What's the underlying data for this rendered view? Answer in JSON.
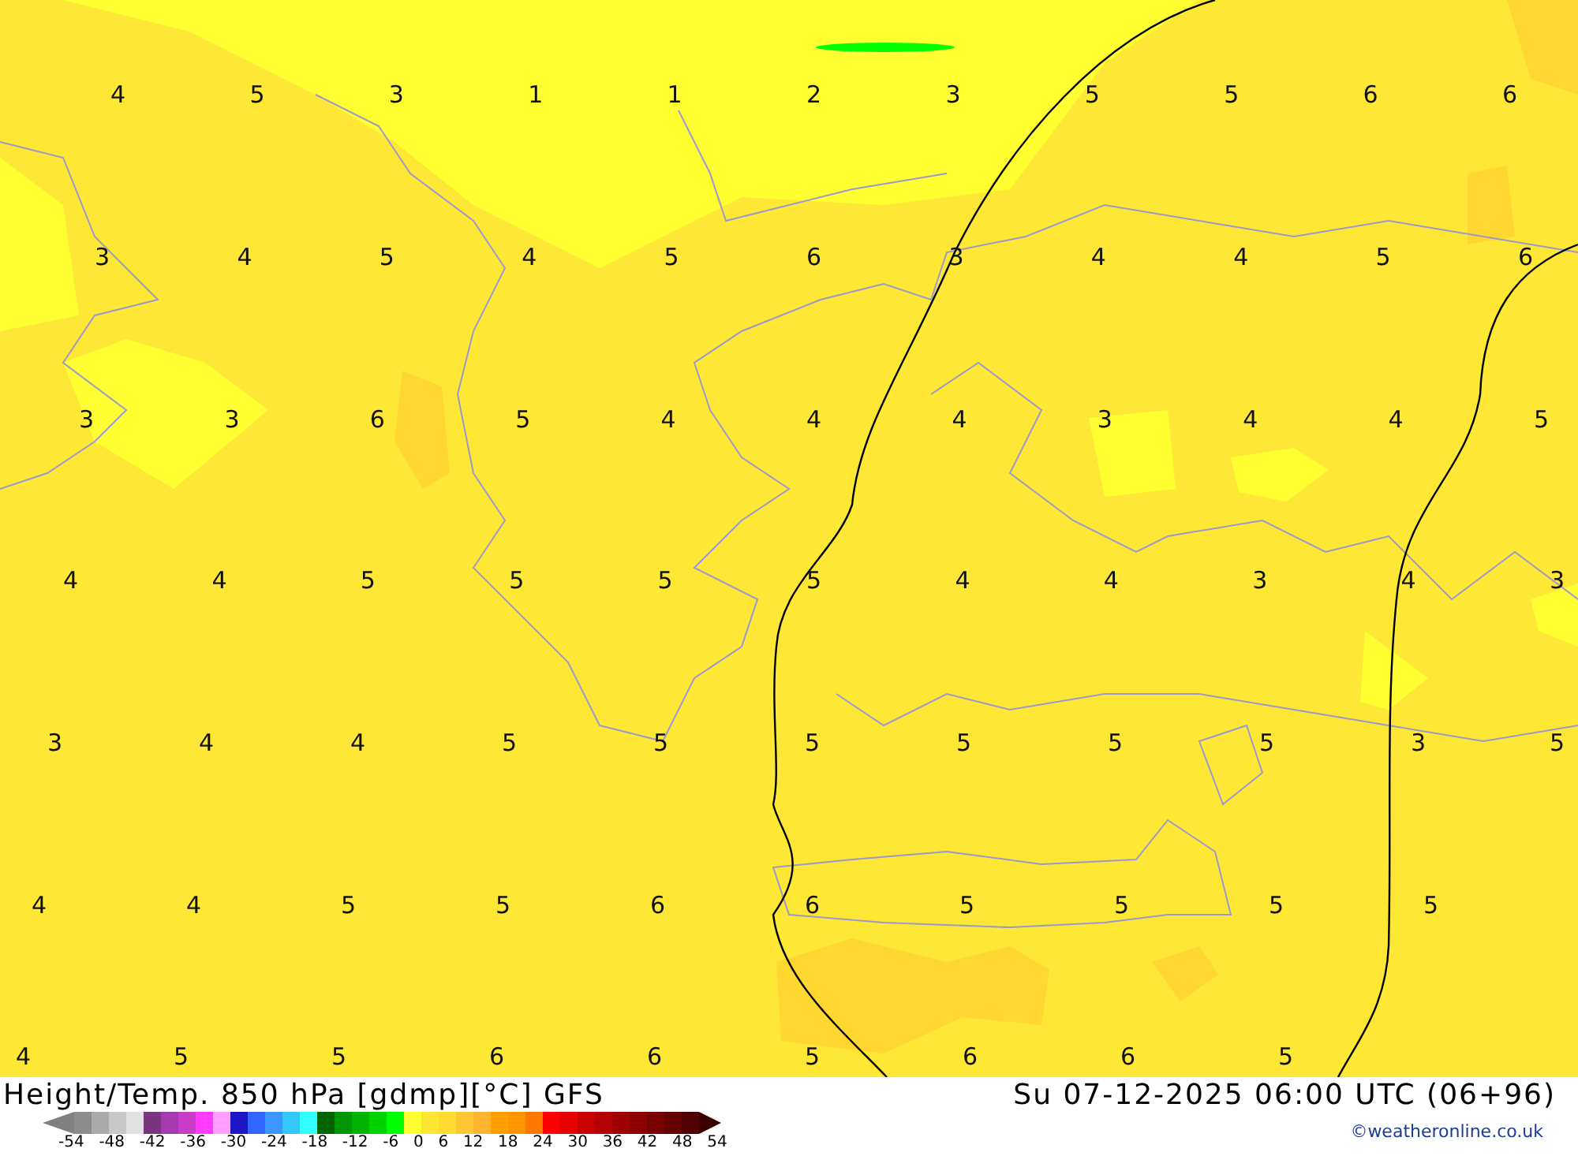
{
  "map": {
    "value_rows": [
      [
        "4",
        "5",
        "3",
        "1",
        "1",
        "2",
        "3",
        "5",
        "5",
        "6",
        "6"
      ],
      [
        "3",
        "4",
        "5",
        "4",
        "5",
        "6",
        "3",
        "4",
        "4",
        "5",
        "6"
      ],
      [
        "3",
        "3",
        "6",
        "5",
        "4",
        "4",
        "4",
        "3",
        "4",
        "4",
        "5"
      ],
      [
        "4",
        "4",
        "5",
        "5",
        "5",
        "5",
        "4",
        "4",
        "3",
        "4",
        "3"
      ],
      [
        "3",
        "4",
        "4",
        "5",
        "5",
        "5",
        "5",
        "5",
        "5",
        "3",
        "5"
      ],
      [
        "4",
        "4",
        "5",
        "5",
        "6",
        "6",
        "5",
        "5",
        "5",
        "5"
      ],
      [
        "4",
        "5",
        "5",
        "6",
        "6",
        "5",
        "6",
        "6",
        "5"
      ]
    ]
  },
  "footer": {
    "title": "Height/Temp. 850 hPa [gdmp][°C] GFS",
    "datetime": "Su 07-12-2025 06:00 UTC (06+96)",
    "credit": "©weatheronline.co.uk",
    "scale": {
      "swatches": [
        {
          "color": "#8c8c8c"
        },
        {
          "color": "#aaaaaa"
        },
        {
          "color": "#c8c8c8"
        },
        {
          "color": "#e1e1e1"
        },
        {
          "color": "#7a3580"
        },
        {
          "color": "#a53aae"
        },
        {
          "color": "#c83cc8"
        },
        {
          "color": "#ff3cff"
        },
        {
          "color": "#ffa0ff"
        },
        {
          "color": "#1e14c8"
        },
        {
          "color": "#3264ff"
        },
        {
          "color": "#3c96ff"
        },
        {
          "color": "#32c8ff"
        },
        {
          "color": "#32ffff"
        },
        {
          "color": "#006400"
        },
        {
          "color": "#009600"
        },
        {
          "color": "#00b400"
        },
        {
          "color": "#00d200"
        },
        {
          "color": "#00ff00"
        },
        {
          "color": "#ffff32"
        },
        {
          "color": "#ffe632"
        },
        {
          "color": "#ffdc32"
        },
        {
          "color": "#ffc832"
        },
        {
          "color": "#ffb432"
        },
        {
          "color": "#ffa000"
        },
        {
          "color": "#ff9600"
        },
        {
          "color": "#ff7800"
        },
        {
          "color": "#ff0000"
        },
        {
          "color": "#e60000"
        },
        {
          "color": "#c80000"
        },
        {
          "color": "#b40000"
        },
        {
          "color": "#a00000"
        },
        {
          "color": "#8c0000"
        },
        {
          "color": "#780000"
        },
        {
          "color": "#640000"
        },
        {
          "color": "#500000"
        }
      ],
      "labels": [
        "-54",
        "-48",
        "-42",
        "-36",
        "-30",
        "-24",
        "-18",
        "-12",
        "-6",
        "0",
        "6",
        "12",
        "18",
        "24",
        "30",
        "36",
        "42",
        "48",
        "54"
      ]
    }
  }
}
